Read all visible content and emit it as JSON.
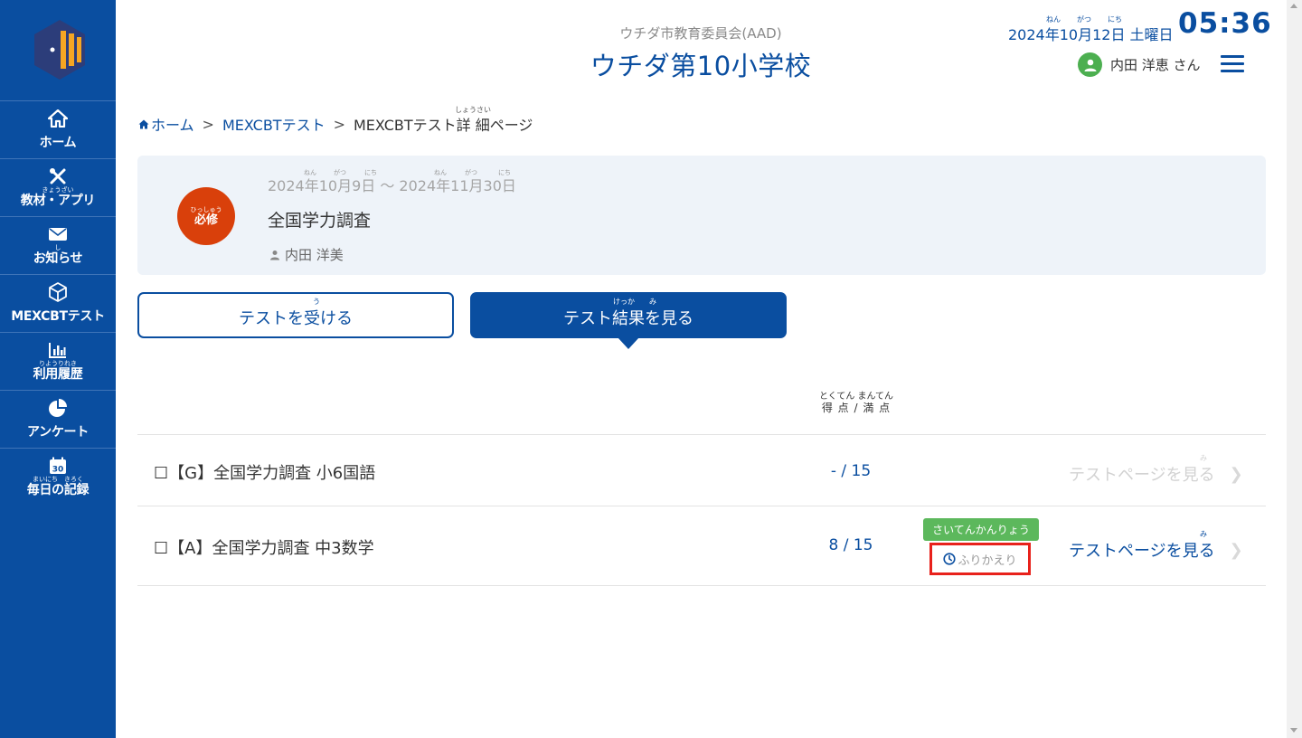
{
  "sidebar": {
    "logo": "school-logo",
    "items": [
      {
        "icon": "home-icon",
        "ruby": "",
        "label": "ホーム"
      },
      {
        "icon": "tools-icon",
        "ruby": "きょうざい",
        "label": "教材・アプリ"
      },
      {
        "icon": "mail-icon",
        "ruby": "し",
        "label": "お知らせ"
      },
      {
        "icon": "cube-icon",
        "ruby": "",
        "label": "MEXCBTテスト"
      },
      {
        "icon": "bar-chart-icon",
        "ruby": "りようりれき",
        "label": "利用履歴"
      },
      {
        "icon": "pie-chart-icon",
        "ruby": "",
        "label": "アンケート"
      },
      {
        "icon": "calendar-icon",
        "ruby": "まいにち　きろく",
        "label": "毎日の記録",
        "calendar_day": "30"
      }
    ]
  },
  "header": {
    "board": "ウチダ市教育委員会(AAD)",
    "school": "ウチダ第10小学校",
    "date": "2024年10月12日 土曜日",
    "date_ruby": {
      "year": "ねん",
      "month": "がつ",
      "day": "にち"
    },
    "time": "05:36",
    "user": "内田 洋恵 さん"
  },
  "breadcrumb": {
    "home": "ホーム",
    "sep": ">",
    "test": "MEXCBTテスト",
    "current": "MEXCBTテスト詳 細ページ",
    "current_ruby": "しょうさい"
  },
  "card": {
    "badge_ruby": "ひっしゅう",
    "badge": "必修",
    "period": "2024年10月9日 〜 2024年11月30日",
    "period_ruby": "ねん",
    "period_ruby_month": "がつ",
    "period_ruby_day": "にち",
    "title": "全国学力調査",
    "author": "内田 洋美"
  },
  "buttons": {
    "take": "テストを受ける",
    "take_ruby": "う",
    "result": "テスト結果を見る",
    "result_ruby": "けっか　　み"
  },
  "table": {
    "score_header_ruby": "とくてん まんてん",
    "score_header": "得 点 / 満 点",
    "link_ruby": "み",
    "rows": [
      {
        "name": "☐【G】全国学力調査 小6国語",
        "score": "- / 15",
        "link": "テストページを見る"
      },
      {
        "name": "☐【A】全国学力調査 中3数学",
        "score": "8 / 15",
        "tag": "さいてんかんりょう",
        "review": "ふりかえり",
        "link": "テストページを見る"
      }
    ]
  },
  "colors": {
    "primary": "#0a4ea0",
    "badge": "#d9400b",
    "tag": "#5cb85c",
    "highlight": "#e8211b"
  }
}
